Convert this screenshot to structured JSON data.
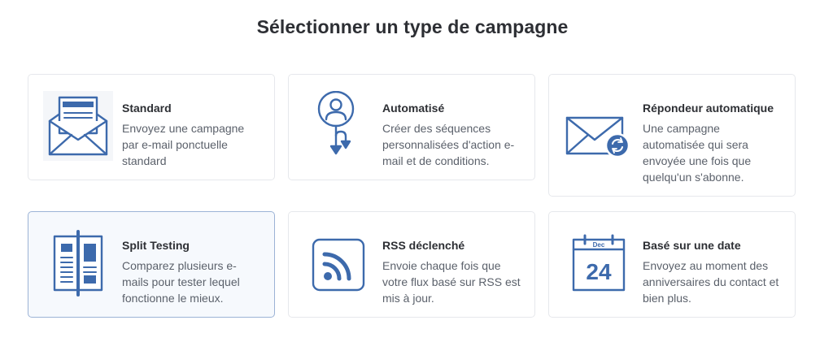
{
  "page": {
    "title": "Sélectionner un type de campagne"
  },
  "colors": {
    "accent": "#3d6aac",
    "selected_border": "#9cb3d6",
    "selected_background": "#f6f9fd",
    "card_border": "#e6e8ec"
  },
  "cards": [
    {
      "icon": "envelope-open-letter-icon",
      "title": "Standard",
      "desc": "Envoyez une campagne par e-mail ponctuelle standard",
      "selected": false
    },
    {
      "icon": "person-flow-icon",
      "title": "Automatisé",
      "desc": "Créer des séquences personnalisées d'action e-mail et de conditions.",
      "selected": false
    },
    {
      "icon": "envelope-refresh-icon",
      "title": "Répondeur automatique",
      "desc": "Une campagne automatisée qui sera envoyée une fois que quelqu'un s'abonne.",
      "selected": false
    },
    {
      "icon": "split-columns-icon",
      "title": "Split Testing",
      "desc": "Comparez plusieurs e-mails pour tester lequel fonctionne le mieux.",
      "selected": true
    },
    {
      "icon": "rss-icon",
      "title": "RSS déclenché",
      "desc": "Envoie chaque fois que votre flux basé sur RSS est mis à jour.",
      "selected": false
    },
    {
      "icon": "calendar-icon",
      "title": "Basé sur une date",
      "desc": "Envoyez au moment des anniversaires du contact et bien plus.",
      "selected": false,
      "calendar_month": "Dec",
      "calendar_day": "24"
    }
  ]
}
